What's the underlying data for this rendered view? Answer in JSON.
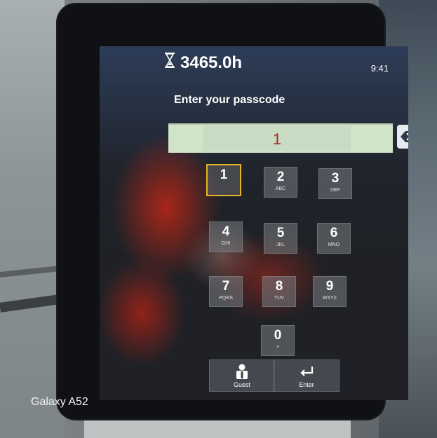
{
  "device": {
    "hour_meter": "3465.0h",
    "time": "9:41",
    "prompt": "Enter your passcode",
    "passcode_value": "1"
  },
  "keypad": [
    {
      "digit": "1",
      "letters": "",
      "selected": true
    },
    {
      "digit": "2",
      "letters": "ABC"
    },
    {
      "digit": "3",
      "letters": "DEF"
    },
    {
      "digit": "4",
      "letters": "GHI"
    },
    {
      "digit": "5",
      "letters": "JKL"
    },
    {
      "digit": "6",
      "letters": "MNO"
    },
    {
      "digit": "7",
      "letters": "PQRS"
    },
    {
      "digit": "8",
      "letters": "TUV"
    },
    {
      "digit": "9",
      "letters": "WXYZ"
    },
    {
      "digit": "0",
      "letters": "+"
    }
  ],
  "buttons": {
    "guest": "Guest",
    "enter": "Enter"
  },
  "icons": {
    "hourglass": "hourglass-icon",
    "backspace": "backspace-icon",
    "guest": "person-icon",
    "enter": "return-arrow-icon"
  },
  "colors": {
    "selected_key_border": "#e6b422",
    "passcode_field": "#cfe4c9",
    "passcode_text": "#b3261e"
  },
  "watermark": "Galaxy A52"
}
